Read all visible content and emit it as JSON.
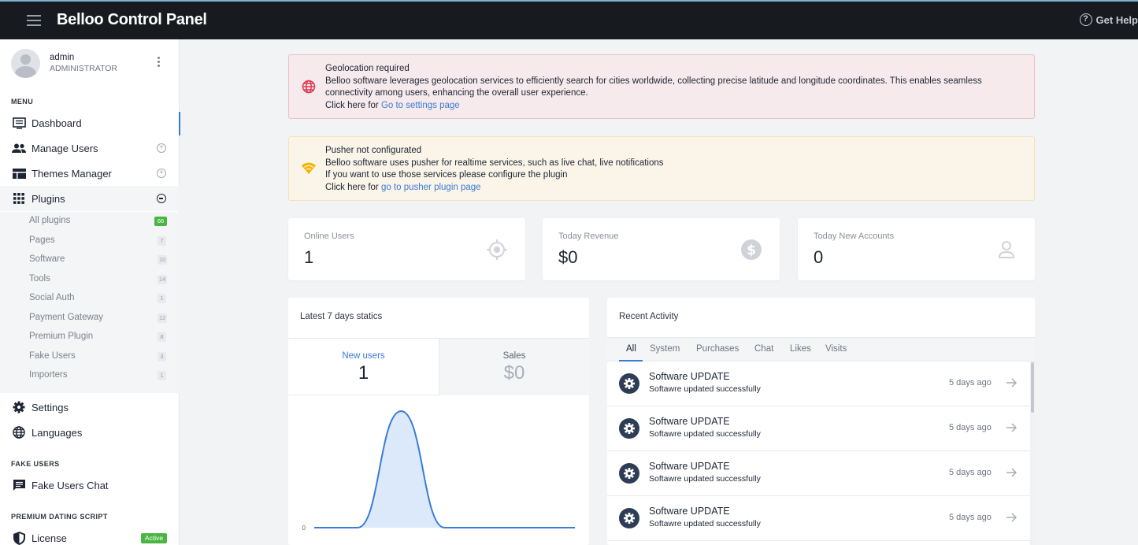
{
  "topbar": {
    "title": "Belloo Control Panel",
    "help_label": "Get Help",
    "icons": {
      "menu": "hamburger-icon",
      "help": "help-circle-icon"
    }
  },
  "profile": {
    "name": "admin",
    "role": "ADMINISTRATOR"
  },
  "sidebar": {
    "menu_label": "MENU",
    "items": [
      {
        "label": "Dashboard",
        "icon": "dashboard-icon"
      },
      {
        "label": "Manage Users",
        "icon": "users-icon"
      },
      {
        "label": "Themes Manager",
        "icon": "themes-icon"
      },
      {
        "label": "Plugins",
        "icon": "grid-icon"
      },
      {
        "label": "Settings",
        "icon": "gear-icon"
      },
      {
        "label": "Languages",
        "icon": "globe-icon"
      }
    ],
    "plugins": [
      {
        "label": "All plugins",
        "count": "66"
      },
      {
        "label": "Pages",
        "count": "7"
      },
      {
        "label": "Software",
        "count": "10"
      },
      {
        "label": "Tools",
        "count": "14"
      },
      {
        "label": "Social Auth",
        "count": "1"
      },
      {
        "label": "Payment Gateway",
        "count": "12"
      },
      {
        "label": "Premium Plugin",
        "count": "8"
      },
      {
        "label": "Fake Users",
        "count": "3"
      },
      {
        "label": "Importers",
        "count": "1"
      }
    ],
    "fake_users_label": "FAKE USERS",
    "fake_users_chat": "Fake Users Chat",
    "premium_label": "PREMIUM DATING SCRIPT",
    "license_label": "License",
    "license_badge": "Active"
  },
  "alerts": {
    "geo": {
      "title": "Geolocation required",
      "body": "Belloo software leverages geolocation services to efficiently search for cities worldwide, collecting precise latitude and longitude coordinates. This enables seamless connectivity among users, enhancing the overall user experience.",
      "prefix": "Click here for",
      "link": "Go to settings page",
      "color": "#e0384f"
    },
    "pusher": {
      "title": "Pusher not configurated",
      "line1": "Belloo software uses pusher for realtime services, such as live chat, live notifications",
      "line2": "If you want to use those services please configure the plugin",
      "prefix": "Click here for",
      "link": "go to pusher plugin page",
      "color": "#f5b400"
    }
  },
  "stats": [
    {
      "label": "Online Users",
      "value": "1",
      "icon": "target-icon"
    },
    {
      "label": "Today Revenue",
      "value": "$0",
      "icon": "dollar-icon"
    },
    {
      "label": "Today New Accounts",
      "value": "0",
      "icon": "user-icon"
    }
  ],
  "statics": {
    "title": "Latest 7 days statics",
    "tab_new_users": "New users",
    "new_users_value": "1",
    "tab_sales": "Sales",
    "sales_value": "$0"
  },
  "chart_data": {
    "type": "area",
    "series": [
      {
        "values": [
          0,
          0,
          1,
          0,
          0,
          0,
          0
        ]
      }
    ],
    "yticks": [
      "0"
    ],
    "ymin": 0,
    "ymax": 1,
    "grid": false,
    "color": "#3a7bd5"
  },
  "activity": {
    "title": "Recent Activity",
    "tabs": [
      "All",
      "System",
      "Purchases",
      "Chat",
      "Likes",
      "Visits"
    ],
    "items": [
      {
        "title": "Software UPDATE",
        "desc": "Softawre updated successfully",
        "time": "5 days ago"
      },
      {
        "title": "Software UPDATE",
        "desc": "Softawre updated successfully",
        "time": "5 days ago"
      },
      {
        "title": "Software UPDATE",
        "desc": "Softawre updated successfully",
        "time": "5 days ago"
      },
      {
        "title": "Software UPDATE",
        "desc": "Softawre updated successfully",
        "time": "5 days ago"
      }
    ]
  },
  "colors": {
    "accent": "#3a7bd5",
    "topbar": "#171a1f",
    "active_green": "#4bb543"
  }
}
